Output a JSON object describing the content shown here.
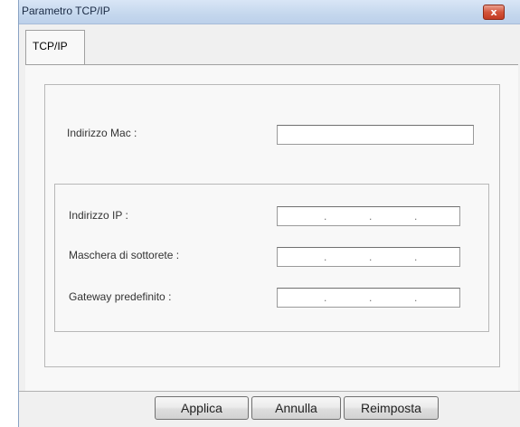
{
  "window": {
    "title": "Parametro TCP/IP",
    "close_glyph": "x"
  },
  "tabs": [
    {
      "label": "TCP/IP"
    }
  ],
  "mac": {
    "label": "Indirizzo Mac :",
    "value": ""
  },
  "network": {
    "ip_label": "Indirizzo IP :",
    "subnet_label": "Maschera di sottorete :",
    "gateway_label": "Gateway predefinito :",
    "ip_separator": "."
  },
  "buttons": {
    "apply": "Applica",
    "cancel": "Annulla",
    "reset": "Reimposta"
  }
}
